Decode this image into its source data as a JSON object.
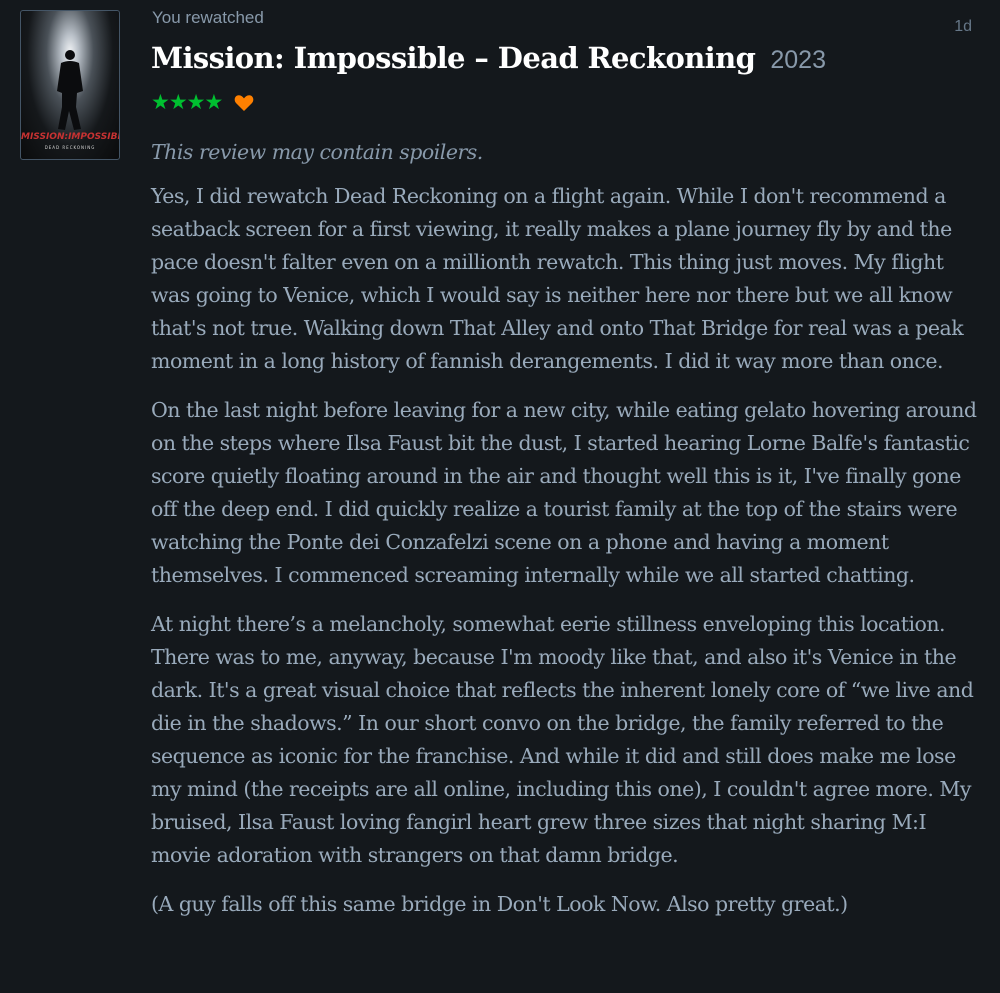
{
  "review": {
    "activity_label": "You rewatched",
    "age": "1d",
    "film": {
      "title": "Mission: Impossible – Dead Reckoning",
      "year": "2023",
      "poster": {
        "logo_text": "MISSION:IMPOSSIBLE",
        "subtitle_text": "DEAD RECKONING"
      }
    },
    "rating": {
      "stars": 4,
      "stars_text": "★★★★",
      "liked": true
    },
    "spoiler_notice": "This review may contain spoilers.",
    "paragraphs": [
      "Yes, I did rewatch Dead Reckoning on a flight again. While I don't recommend a seatback screen for a first viewing, it really makes a plane journey fly by and the pace doesn't falter even on a millionth rewatch. This thing just moves. My flight was going to Venice, which I would say is neither here nor there but we all know that's not true. Walking down That Alley and onto That Bridge for real was a peak moment in a long history of fannish derangements. I did it way more than once.",
      "On the last night before leaving for a new city, while eating gelato hovering around on the steps where Ilsa Faust bit the dust, I started hearing Lorne Balfe's fantastic score quietly floating around in the air and thought well this is it, I've finally gone off the deep end. I did quickly realize a tourist family at the top of the stairs were watching the Ponte dei Conzafelzi scene on a phone and having a moment themselves. I commenced screaming internally while we all started chatting.",
      "At night there’s a melancholy, somewhat eerie stillness enveloping this location. There was to me, anyway, because I'm moody like that, and also it's Venice in the dark. It's a great visual choice that reflects the inherent lonely core of “we live and die in the shadows.” In our short convo on the bridge, the family referred to the sequence as iconic for the franchise. And while it did and still does make me lose my mind (the receipts are all online, including this one), I couldn't agree more. My bruised, Ilsa Faust loving fangirl heart grew three sizes that night sharing M:I movie adoration with strangers on that damn bridge.",
      "(A guy falls off this same bridge in Don't Look Now. Also pretty great.)"
    ]
  },
  "colors": {
    "background": "#14181c",
    "title": "#ffffff",
    "body_text": "#99aabb",
    "muted_text": "#8899aa",
    "star_green": "#00c030",
    "heart_orange": "#ff8000"
  },
  "icons": {
    "rating": "star-icon",
    "like": "heart-icon"
  }
}
